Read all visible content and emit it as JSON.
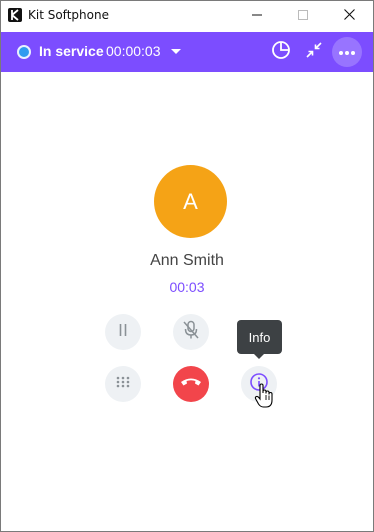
{
  "window": {
    "title": "Kit Softphone",
    "icon": "app-logo-icon",
    "controls": [
      "minimize-icon",
      "maximize-icon",
      "close-icon"
    ]
  },
  "header": {
    "status_label": "In service",
    "status_timer": "00:00:03",
    "status_color": "#2f9bf0",
    "accent_color": "#7c4dff",
    "icons": [
      "pie-chart-icon",
      "minimize-arrows-icon",
      "more-icon"
    ]
  },
  "call": {
    "avatar_initial": "A",
    "avatar_color": "#f5a316",
    "caller_name": "Ann Smith",
    "duration": "00:03"
  },
  "controls": {
    "hold": "pause-icon",
    "mute": "mic-off-icon",
    "keypad": "dialpad-icon",
    "hangup": "phone-hangup-icon",
    "hangup_color": "#f2454b",
    "info": "info-icon"
  },
  "tooltip": {
    "text": "Info"
  }
}
